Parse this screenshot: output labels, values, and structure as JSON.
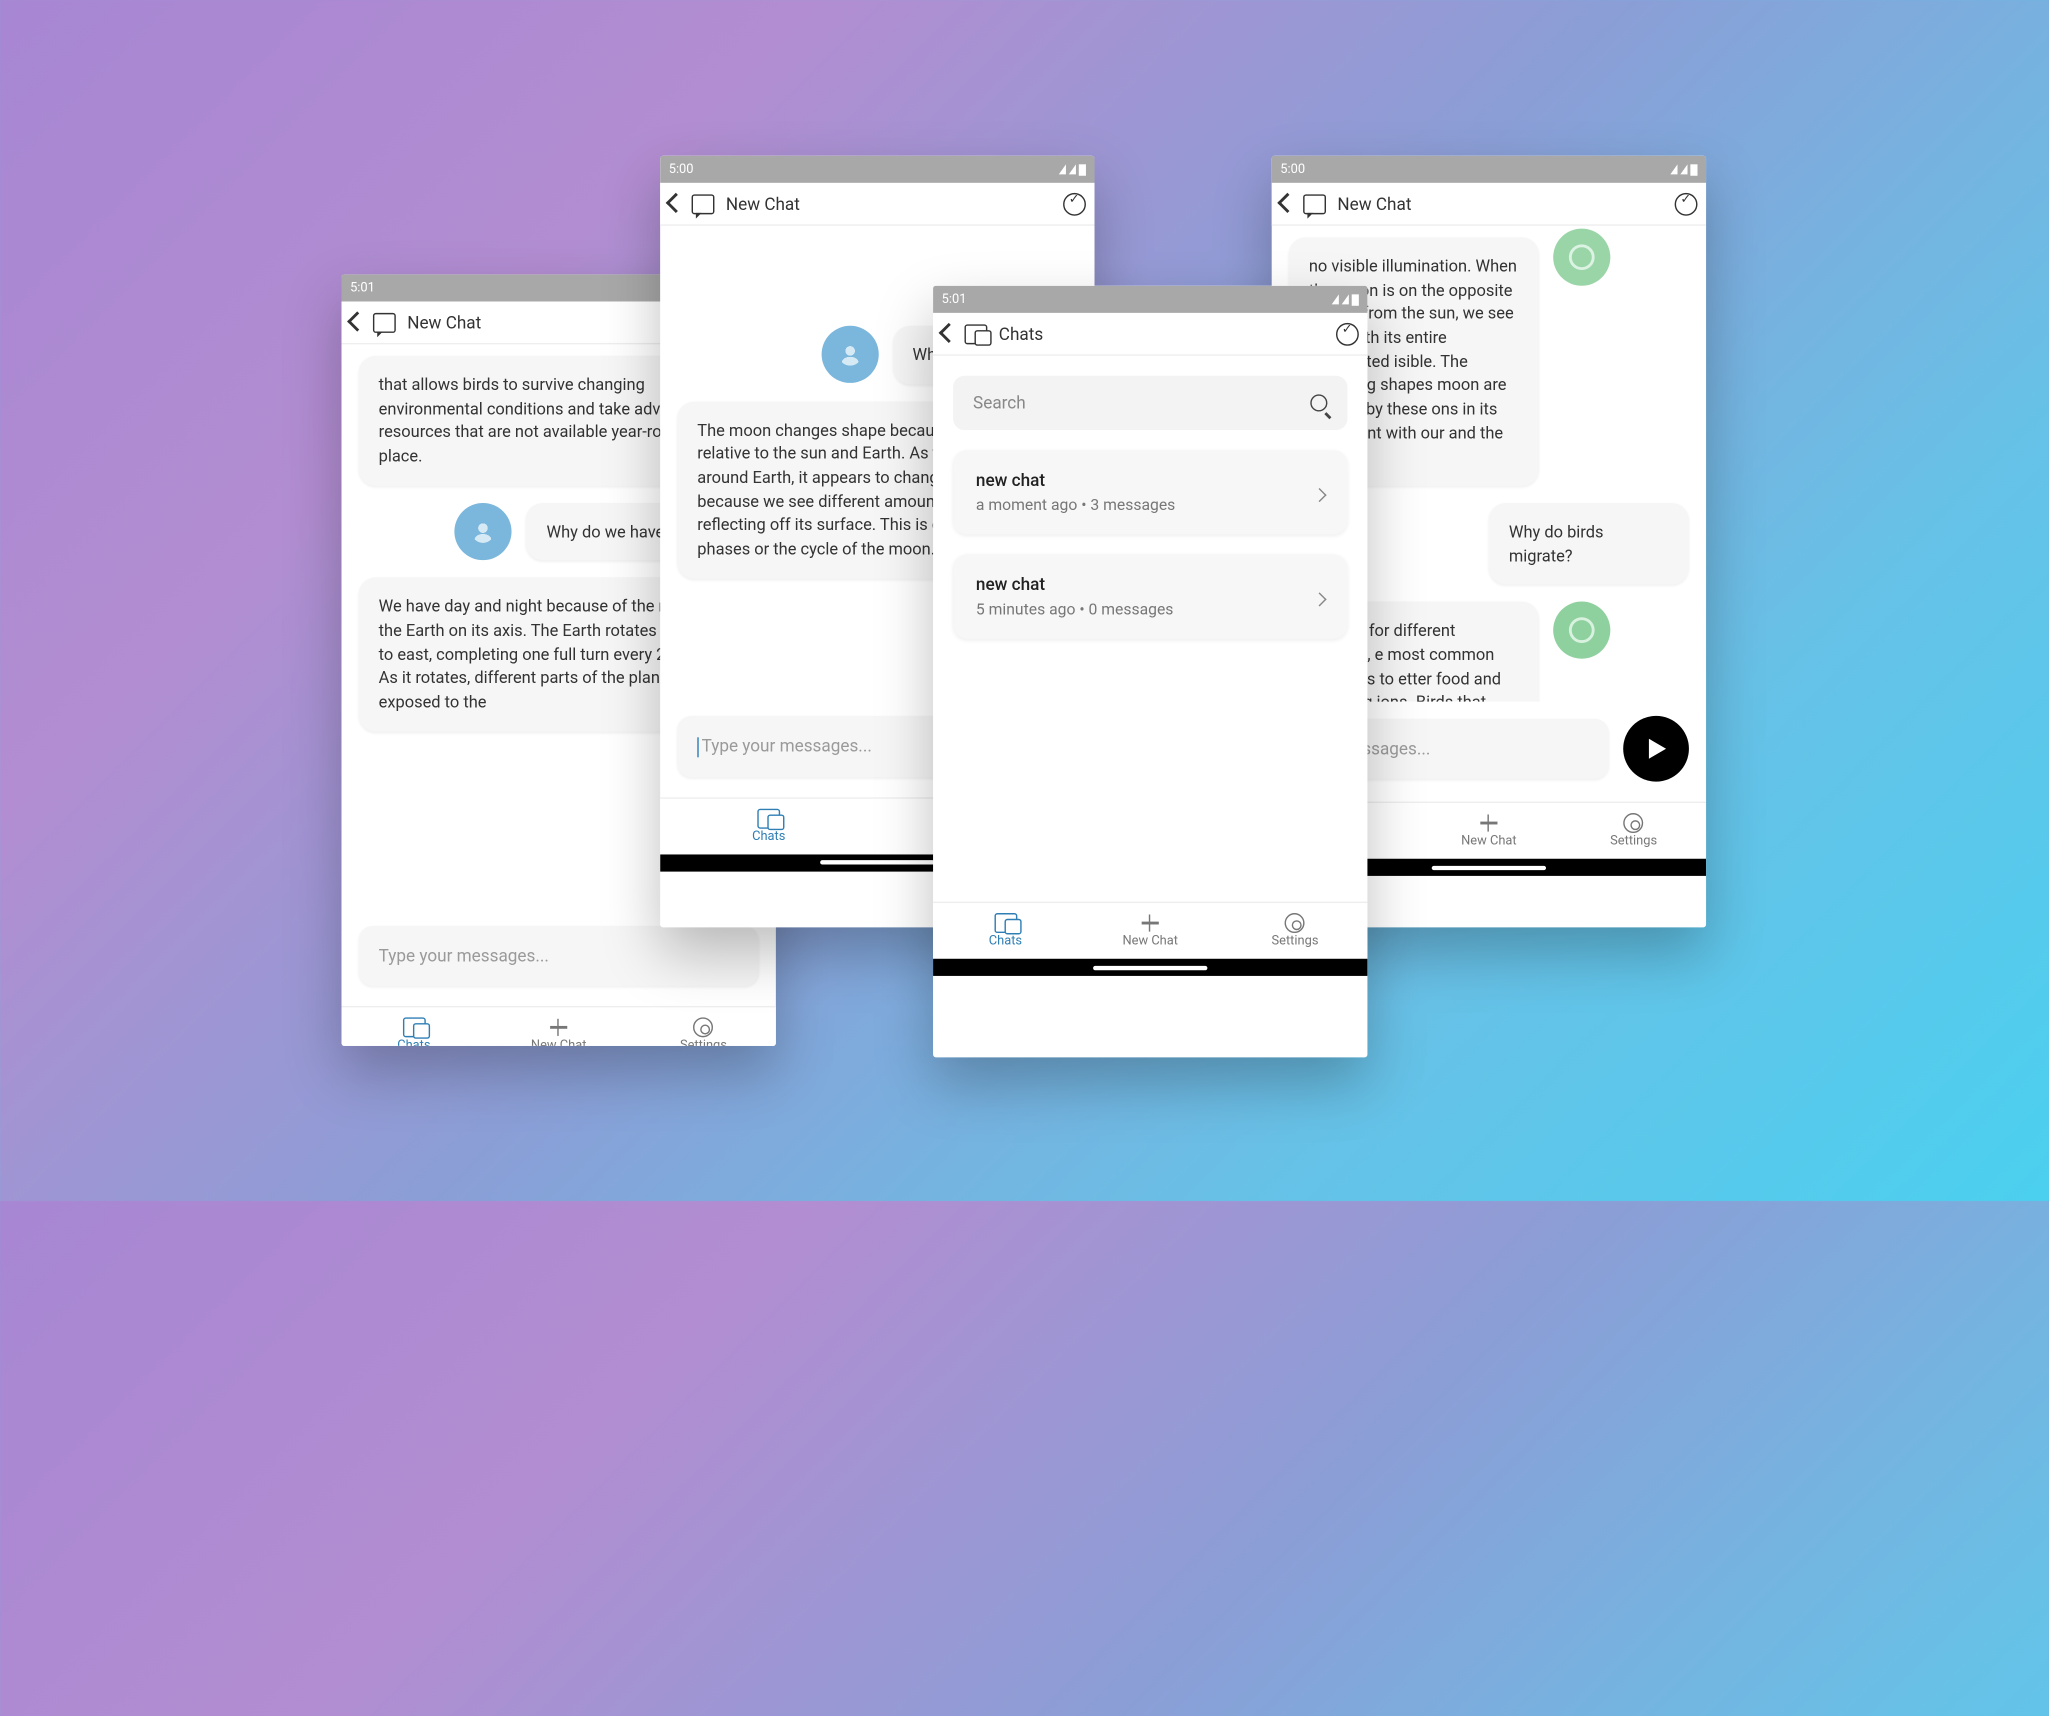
{
  "statusbar": {
    "time_501": "5:01",
    "time_500": "5:00"
  },
  "appbar": {
    "new_chat": "New Chat",
    "chats": "Chats"
  },
  "nav": {
    "chats": "Chats",
    "new_chat": "New Chat",
    "settings": "Settings"
  },
  "composer": {
    "placeholder": "Type your messages...",
    "placeholder_partial": "our messages..."
  },
  "search": {
    "placeholder": "Search"
  },
  "chat_list": [
    {
      "title": "new chat",
      "sub": "a moment ago • 3 messages"
    },
    {
      "title": "new chat",
      "sub": "5 minutes ago • 0 messages"
    }
  ],
  "p1": {
    "bot1": "that allows birds to survive changing environmental conditions and take advantage of resources that are not available year-round in one place.",
    "user1": "Why do we have day and n",
    "bot2": "We have day and night because of the rotation of the Earth on its axis. The Earth rotates from west to east, completing one full turn every 24 hours. As it rotates, different parts of the planet are exposed to the"
  },
  "p2": {
    "user1": "Why does the moon",
    "bot1": "The moon changes shape because of its position relative to the sun and Earth. As the moon orbits around Earth, it appears to change shape because we see different amounts of sunlight reflecting off its surface. This is called lunar phases or the cycle of the moon. When"
  },
  "p4": {
    "bot_top": "no visible illumination. When the moon is on the opposite side of from the sun, we see a full with its entire illuminated isible. The changing shapes moon are caused by these ons in its alignment with our and the sun.",
    "user1": "Why do birds migrate?",
    "bot2": "migrate for different reasons, e most common reason is to etter food and breeding ions. Birds that"
  }
}
